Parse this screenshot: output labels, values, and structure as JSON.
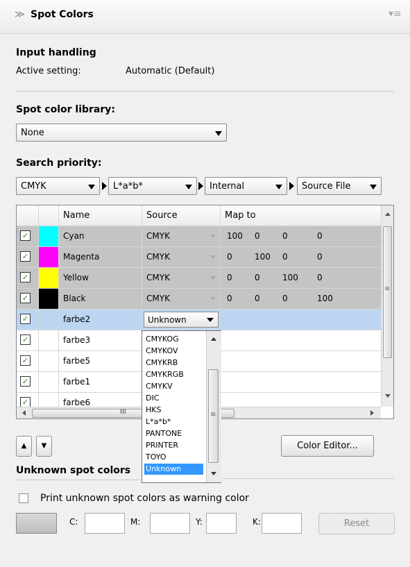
{
  "panel": {
    "title": "Spot Colors"
  },
  "input_handling": {
    "heading": "Input handling",
    "label": "Active setting:",
    "value": "Automatic (Default)"
  },
  "library": {
    "heading": "Spot color library:",
    "value": "None"
  },
  "priority": {
    "heading": "Search priority:",
    "combos": [
      "CMYK",
      "L*a*b*",
      "Internal",
      "Source File"
    ]
  },
  "table": {
    "headers": {
      "name": "Name",
      "source": "Source",
      "map_to": "Map to"
    },
    "rows": [
      {
        "name": "Cyan",
        "source": "CMYK",
        "c": "100",
        "m": "0",
        "y": "0",
        "k": "0",
        "swatch": "#00ffff"
      },
      {
        "name": "Magenta",
        "source": "CMYK",
        "c": "0",
        "m": "100",
        "y": "0",
        "k": "0",
        "swatch": "#ff00ff"
      },
      {
        "name": "Yellow",
        "source": "CMYK",
        "c": "0",
        "m": "0",
        "y": "100",
        "k": "0",
        "swatch": "#ffff00"
      },
      {
        "name": "Black",
        "source": "CMYK",
        "c": "0",
        "m": "0",
        "y": "0",
        "k": "100",
        "swatch": "#000000"
      },
      {
        "name": "farbe2",
        "source": "Unknown"
      },
      {
        "name": "farbe3"
      },
      {
        "name": "farbe5"
      },
      {
        "name": "farbe1"
      },
      {
        "name": "farbe6"
      }
    ],
    "hscroll_grip": "III",
    "vscroll_grip": "≡"
  },
  "source_dropdown": {
    "options": [
      "CMYKOG",
      "CMYKOV",
      "CMYKRB",
      "CMYKRGB",
      "CMYKV",
      "DIC",
      "HKS",
      "L*a*b*",
      "PANTONE",
      "PRINTER",
      "TOYO",
      "Unknown"
    ],
    "selected": "Unknown",
    "grip": "≡"
  },
  "buttons": {
    "up": "▲",
    "down": "▼",
    "color_editor": "Color Editor...",
    "reset": "Reset"
  },
  "unknown": {
    "heading": "Unknown spot colors",
    "checkbox_label": "Print unknown spot colors as warning color",
    "c_label": "C:",
    "m_label": "M:",
    "y_label": "Y:",
    "k_label": "K:"
  }
}
